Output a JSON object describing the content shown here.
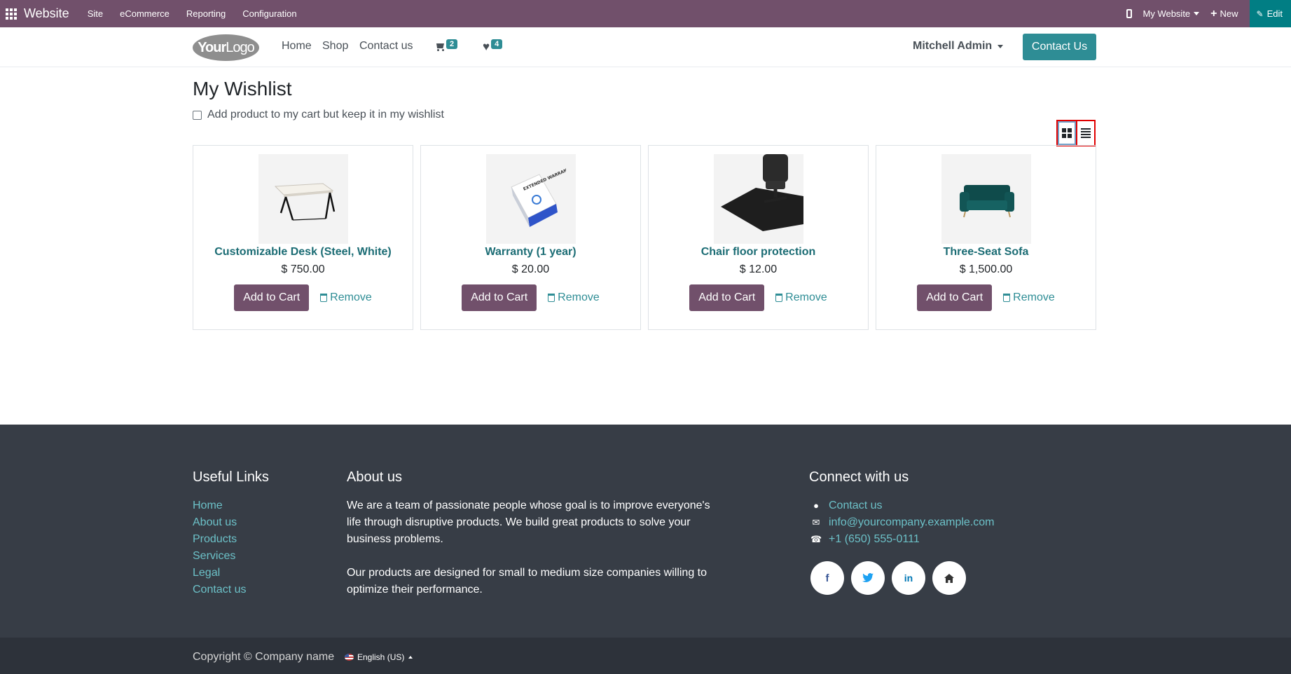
{
  "admin_bar": {
    "title": "Website",
    "menus": [
      "Site",
      "eCommerce",
      "Reporting",
      "Configuration"
    ],
    "website_selector": "My Website",
    "new_label": "New",
    "edit_label": "Edit"
  },
  "header": {
    "logo": {
      "bold": "Your",
      "light": "Logo"
    },
    "nav": [
      "Home",
      "Shop",
      "Contact us"
    ],
    "cart_count": "2",
    "wishlist_count": "4",
    "user": "Mitchell Admin",
    "cta": "Contact Us"
  },
  "main": {
    "title": "My Wishlist",
    "keep_in_wishlist_label": "Add product to my cart but keep it in my wishlist",
    "add_to_cart_label": "Add to Cart",
    "remove_label": "Remove",
    "products": [
      {
        "name": "Customizable Desk (Steel, White)",
        "price": "$ 750.00"
      },
      {
        "name": "Warranty (1 year)",
        "price": "$ 20.00"
      },
      {
        "name": "Chair floor protection",
        "price": "$ 12.00"
      },
      {
        "name": "Three-Seat Sofa",
        "price": "$ 1,500.00"
      }
    ],
    "warranty_box_text": "EXTENDED WARRANTY"
  },
  "footer": {
    "useful_links_title": "Useful Links",
    "useful_links": [
      "Home",
      "About us",
      "Products",
      "Services",
      "Legal",
      "Contact us"
    ],
    "about_title": "About us",
    "about_p1": "We are a team of passionate people whose goal is to improve everyone's life through disruptive products. We build great products to solve your business problems.",
    "about_p2": "Our products are designed for small to medium size companies willing to optimize their performance.",
    "connect_title": "Connect with us",
    "contact_link": "Contact us",
    "email": "info@yourcompany.example.com",
    "phone": "+1 (650) 555-0111",
    "social_glyphs": {
      "facebook": "f",
      "linkedin": "in"
    },
    "copyright": "Copyright © Company name",
    "language": "English (US)"
  },
  "colors": {
    "admin_bar": "#71506b",
    "edit_button": "#017e84",
    "primary_teal": "#2e8d95",
    "product_name": "#1b6c74",
    "add_to_cart": "#71506b",
    "footer": "#373d46"
  }
}
